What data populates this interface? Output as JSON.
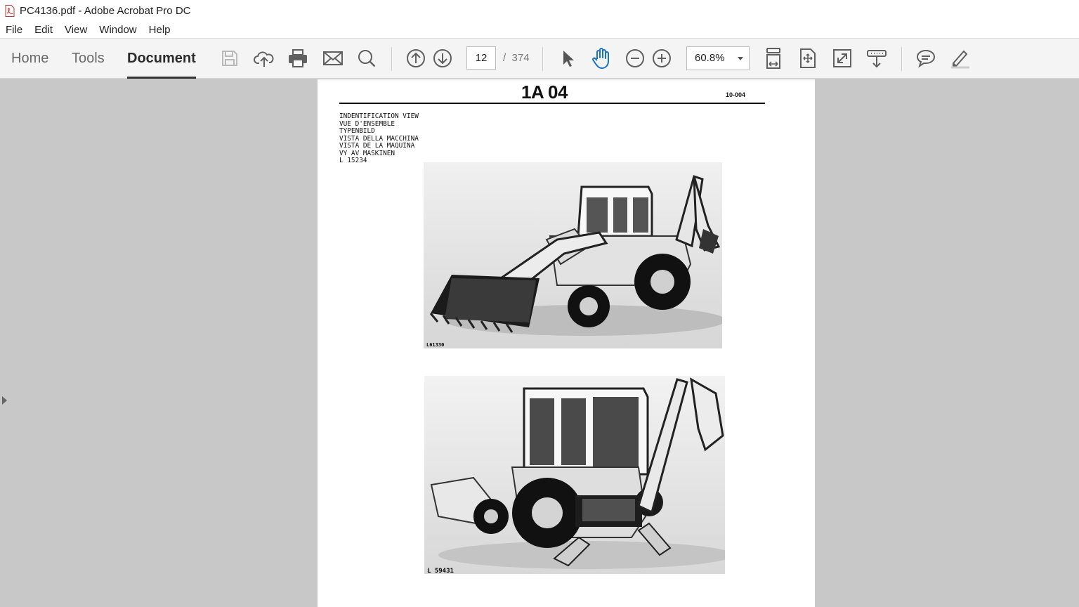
{
  "window": {
    "title": "PC4136.pdf - Adobe Acrobat Pro DC"
  },
  "menu": [
    "File",
    "Edit",
    "View",
    "Window",
    "Help"
  ],
  "toolbar": {
    "tabs": [
      {
        "label": "Home",
        "active": false
      },
      {
        "label": "Tools",
        "active": false
      },
      {
        "label": "Document",
        "active": true
      }
    ],
    "current_page": "12",
    "page_separator": "/",
    "total_pages": "374",
    "zoom": "60.8%",
    "icons": [
      "save-icon",
      "cloud-upload-icon",
      "print-icon",
      "email-icon",
      "search-icon",
      "page-up-icon",
      "page-down-icon",
      "select-arrow-icon",
      "hand-tool-icon",
      "zoom-out-icon",
      "zoom-in-icon",
      "fit-width-icon",
      "fit-page-icon",
      "fullscreen-icon",
      "read-mode-icon",
      "comment-icon",
      "pen-icon"
    ],
    "accent_color": "#1a73c8"
  },
  "document": {
    "heading": "1A 04",
    "code": "10-004",
    "lines": [
      "INDENTIFICATION VIEW",
      "VUE D'ENSEMBLE",
      "TYPENBILD",
      "VISTA DELLA MACCHINA",
      "VISTA DE LA MAQUINA",
      "VY AV MASKINEN",
      "L 15234"
    ],
    "photos": [
      {
        "label": "L61330",
        "subject": "backhoe-loader-front-view"
      },
      {
        "label": "L 59431",
        "subject": "backhoe-loader-rear-view"
      }
    ]
  }
}
